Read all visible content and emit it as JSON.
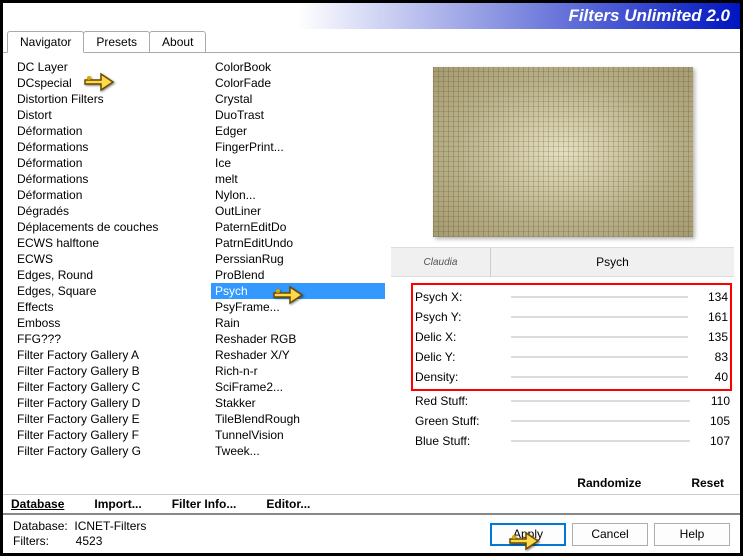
{
  "titlebar": "Filters Unlimited 2.0",
  "tabs": {
    "navigator": "Navigator",
    "presets": "Presets",
    "about": "About"
  },
  "categories": [
    "DC Layer",
    "DCspecial",
    "Distortion Filters",
    "Distort",
    "Déformation",
    "Déformations",
    "Déformation",
    "Déformations",
    "Déformation",
    "Dégradés",
    "Déplacements de couches",
    "ECWS halftone",
    "ECWS",
    "Edges, Round",
    "Edges, Square",
    "Effects",
    "Emboss",
    "FFG???",
    "Filter Factory Gallery A",
    "Filter Factory Gallery B",
    "Filter Factory Gallery C",
    "Filter Factory Gallery D",
    "Filter Factory Gallery E",
    "Filter Factory Gallery F",
    "Filter Factory Gallery G"
  ],
  "filters": [
    "ColorBook",
    "ColorFade",
    "Crystal",
    "DuoTrast",
    "Edger",
    "FingerPrint...",
    "Ice",
    "melt",
    "Nylon...",
    "OutLiner",
    "PaternEditDo",
    "PatrnEditUndo",
    "PerssianRug",
    "ProBlend",
    "Psych",
    "PsyFrame...",
    "Rain",
    "Reshader RGB",
    "Reshader X/Y",
    "Rich-n-r",
    "SciFrame2...",
    "Stakker",
    "TileBlendRough",
    "TunnelVision",
    "Tweek..."
  ],
  "selected_filter_index": 14,
  "stamp": "Claudia",
  "filter_name": "Psych",
  "sliders": {
    "boxed": [
      {
        "label": "Psych X:",
        "value": 134
      },
      {
        "label": "Psych Y:",
        "value": 161
      },
      {
        "label": "Delic X:",
        "value": 135
      },
      {
        "label": "Delic Y:",
        "value": 83
      },
      {
        "label": "Density:",
        "value": 40
      }
    ],
    "rest": [
      {
        "label": "Red Stuff:",
        "value": 110
      },
      {
        "label": "Green Stuff:",
        "value": 105
      },
      {
        "label": "Blue Stuff:",
        "value": 107
      }
    ]
  },
  "bottom_buttons": {
    "database": "Database",
    "import": "Import...",
    "filter_info": "Filter Info...",
    "editor": "Editor...",
    "randomize": "Randomize",
    "reset": "Reset"
  },
  "status": {
    "db_label": "Database:",
    "db_value": "ICNET-Filters",
    "filters_label": "Filters:",
    "filters_value": "4523"
  },
  "actions": {
    "apply": "Apply",
    "cancel": "Cancel",
    "help": "Help"
  }
}
